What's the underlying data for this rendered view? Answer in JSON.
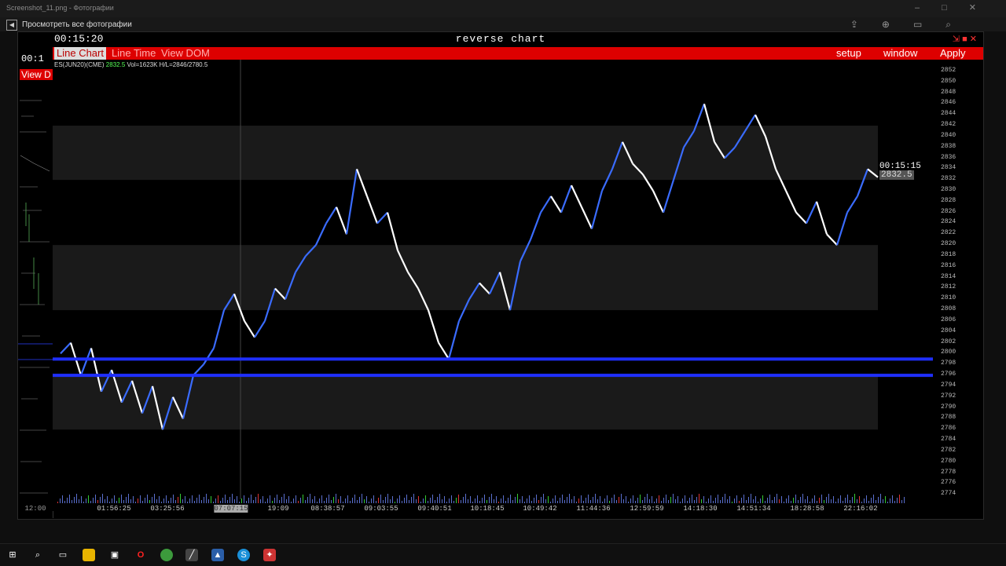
{
  "viewer": {
    "title": "Screenshot_11.png - Фотографии",
    "label": "Просмотреть все фотографии",
    "back_icon": "back-arrow-icon"
  },
  "window": {
    "clock": "00:15:20",
    "title": "reverse chart",
    "left_clock": "00:1",
    "left_view": "View D"
  },
  "menu": {
    "items": [
      "Line Chart",
      "Line Time",
      "View DOM"
    ],
    "right": [
      "setup",
      "window",
      "Apply"
    ]
  },
  "info": {
    "symbol": "ES(JUN20)(CME)",
    "price": "2832.5",
    "vol": "Vol=1623K",
    "hl": "H/L=2846/2780.5"
  },
  "price_label": {
    "time": "00:15:15",
    "price": "2832.5"
  },
  "chart_data": {
    "type": "line",
    "ylim": [
      2772,
      2853
    ],
    "yticks": [
      "2852",
      "2850",
      "2848",
      "2846",
      "2844",
      "2842",
      "2840",
      "2838",
      "2836",
      "2834",
      "2832",
      "2830",
      "2828",
      "2826",
      "2824",
      "2822",
      "2820",
      "2818",
      "2816",
      "2814",
      "2812",
      "2810",
      "2808",
      "2806",
      "2804",
      "2802",
      "2800",
      "2798",
      "2796",
      "2794",
      "2792",
      "2790",
      "2788",
      "2786",
      "2784",
      "2782",
      "2780",
      "2778",
      "2776",
      "2774"
    ],
    "xticks": [
      "01:56:25",
      "03:25:56",
      "07:07:15",
      "19:09",
      "08:38:57",
      "09:03:55",
      "09:40:51",
      "10:18:45",
      "10:49:42",
      "11:44:36",
      "12:59:59",
      "14:18:30",
      "14:51:34",
      "18:28:58",
      "22:16:02"
    ],
    "x_left_label": "12:00",
    "series": [
      {
        "values": [
          2800,
          2802,
          2796,
          2801,
          2793,
          2797,
          2791,
          2795,
          2789,
          2794,
          2786,
          2792,
          2788,
          2796,
          2798,
          2801,
          2808,
          2811,
          2806,
          2803,
          2806,
          2812,
          2810,
          2815,
          2818,
          2820,
          2824,
          2827,
          2822,
          2834,
          2829,
          2824,
          2826,
          2819,
          2815,
          2812,
          2808,
          2802,
          2799,
          2806,
          2810,
          2813,
          2811,
          2815,
          2808,
          2817,
          2821,
          2826,
          2829,
          2826,
          2831,
          2827,
          2823,
          2830,
          2834,
          2839,
          2835,
          2833,
          2830,
          2826,
          2832,
          2838,
          2841,
          2846,
          2839,
          2836,
          2838,
          2841,
          2844,
          2840,
          2834,
          2830,
          2826,
          2824,
          2828,
          2822,
          2820,
          2826,
          2829,
          2834,
          2832.5
        ]
      }
    ],
    "levels": [
      2799,
      2796
    ],
    "zones": [
      [
        2842,
        2832
      ],
      [
        2820,
        2808
      ],
      [
        2796,
        2786
      ]
    ]
  },
  "colors": {
    "up": "#3a6cff",
    "down": "#ffffff",
    "menu": "#dd0000",
    "level": "#1f2fff"
  },
  "taskbar": {
    "items": [
      "windows-start-icon",
      "search-icon",
      "task-view-icon",
      "file-explorer-icon",
      "store-icon",
      "opera-icon",
      "chrome-icon",
      "terminal-app-icon",
      "photos-icon",
      "skype-icon",
      "app-icon"
    ]
  }
}
